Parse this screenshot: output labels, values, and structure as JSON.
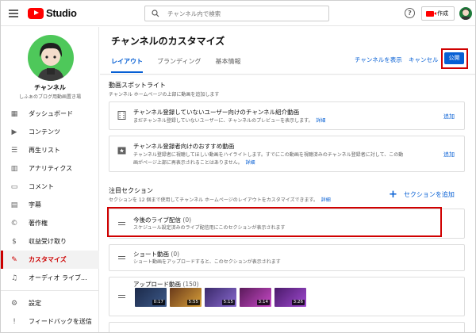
{
  "topbar": {
    "studio_label": "Studio",
    "search_placeholder": "チャンネル内で検索",
    "help_glyph": "?",
    "create_label": "作成"
  },
  "sidebar": {
    "channel_name": "チャンネル",
    "channel_sub": "しふぁのブログ用動画置き場",
    "items": [
      {
        "label": "ダッシュボード",
        "icon": "dashboard-icon"
      },
      {
        "label": "コンテンツ",
        "icon": "content-icon"
      },
      {
        "label": "再生リスト",
        "icon": "playlist-icon"
      },
      {
        "label": "アナリティクス",
        "icon": "analytics-icon"
      },
      {
        "label": "コメント",
        "icon": "comment-icon"
      },
      {
        "label": "字幕",
        "icon": "subtitles-icon"
      },
      {
        "label": "著作権",
        "icon": "copyright-icon"
      },
      {
        "label": "収益受け取り",
        "icon": "monetization-icon"
      },
      {
        "label": "カスタマイズ",
        "icon": "customize-icon",
        "active": true
      },
      {
        "label": "オーディオ ライブ...",
        "icon": "audio-library-icon"
      }
    ],
    "bottom_items": [
      {
        "label": "設定",
        "icon": "settings-icon"
      },
      {
        "label": "フィードバックを送信",
        "icon": "feedback-icon"
      }
    ]
  },
  "header": {
    "title": "チャンネルのカスタマイズ",
    "tabs": [
      {
        "label": "レイアウト",
        "active": true
      },
      {
        "label": "ブランディング",
        "active": false
      },
      {
        "label": "基本情報",
        "active": false
      }
    ],
    "view_channel": "チャンネルを表示",
    "cancel": "キャンセル",
    "publish": "公開"
  },
  "spotlight": {
    "title": "動画スポットライト",
    "desc": "チャンネル ホームページの上部に動画を追加します",
    "cards": [
      {
        "title": "チャンネル登録していないユーザー向けのチャンネル紹介動画",
        "desc": "まだチャンネル登録していないユーザーに、チャンネルのプレビューを表示します。",
        "link": "詳細",
        "action": "追加"
      },
      {
        "title": "チャンネル登録者向けのおすすめ動画",
        "desc1": "チャンネル登録者に視聴してほしい動画をハイライトします。すでにこの動画を視聴済みのチャンネル登録者に対して、この動",
        "desc2": "画がページ上部に再表示されることはありません。",
        "link": "詳細",
        "action": "追加"
      }
    ]
  },
  "featured": {
    "title": "注目セクション",
    "desc": "セクションを 12 個まで使用してチャンネル ホームページのレイアウトをカスタマイズできます。",
    "link": "詳細",
    "add_section": "セクションを追加",
    "sections": [
      {
        "title": "今後のライブ配信",
        "count": "(0)",
        "desc": "スケジュール設定済みのライブ配信用にこのセクションが表示されます"
      },
      {
        "title": "ショート動画",
        "count": "(0)",
        "desc": "ショート動画をアップロードすると、このセクションが表示されます"
      },
      {
        "title": "アップロード動画",
        "count": "(150)"
      }
    ],
    "thumbnails": [
      {
        "duration": "0:17",
        "color": "#1c2a4a"
      },
      {
        "duration": "5:55",
        "color": "#6a3a1a"
      },
      {
        "duration": "5:15",
        "color": "#3a2a6a"
      },
      {
        "duration": "3:14",
        "color": "#5a1a5a"
      },
      {
        "duration": "3:26",
        "color": "#4a1a6a"
      }
    ]
  }
}
